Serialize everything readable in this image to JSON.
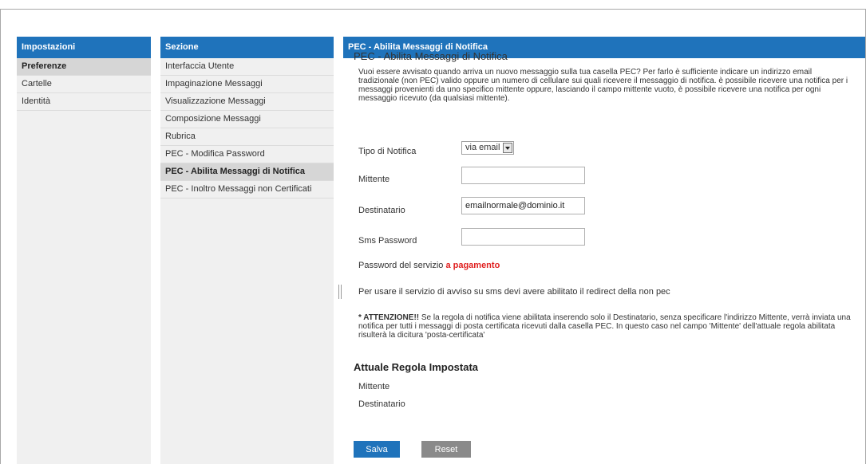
{
  "panel_impostazioni": {
    "header": "Impostazioni",
    "items": [
      "Preferenze",
      "Cartelle",
      "Identità"
    ]
  },
  "panel_sezione": {
    "header": "Sezione",
    "items": [
      "Interfaccia Utente",
      "Impaginazione Messaggi",
      "Visualizzazione Messaggi",
      "Composizione Messaggi",
      "Rubrica",
      "PEC - Modifica Password",
      "PEC - Abilita Messaggi di Notifica",
      "PEC - Inoltro Messaggi non Certificati"
    ]
  },
  "main": {
    "header": "PEC - Abilita Messaggi di Notifica",
    "title": "PEC - Abilita Messaggi di Notifica",
    "intro": "Vuoi essere avvisato quando arriva un nuovo messaggio sulla tua casella PEC? Per farlo è sufficiente indicare un indirizzo email tradizionale (non PEC) valido oppure un numero di cellulare sui quali ricevere il messaggio di notifica. è possibile ricevere una notifica per i messaggi provenienti da uno specifico mittente oppure, lasciando il campo mittente vuoto, è possibile ricevere una notifica per ogni messaggio ricevuto (da qualsiasi mittente).",
    "form": {
      "tipo_label": "Tipo di Notifica",
      "tipo_value": "via email",
      "mittente_label": "Mittente",
      "mittente_value": "",
      "destinatario_label": "Destinatario",
      "destinatario_value": "emailnormale@dominio.it",
      "sms_label": "Sms Password",
      "sms_value": ""
    },
    "paid_prefix": "Password del servizio",
    "paid_highlight": "a pagamento",
    "sms_note": "Per usare il servizio di avviso su sms devi avere abilitato il redirect della non pec",
    "warning_bold": "* ATTENZIONE!!",
    "warning_text": " Se la regola di notifica viene abilitata inserendo solo il Destinatario, senza specificare l'indirizzo Mittente, verrà inviata una notifica per tutti i messaggi di posta certificata ricevuti dalla casella PEC. In questo caso nel campo 'Mittente' dell'attuale regola abilitata risulterà la dicitura 'posta-certificata'",
    "current_rule_title": "Attuale Regola Impostata",
    "current_mittente_label": "Mittente",
    "current_destinatario_label": "Destinatario",
    "save_label": "Salva",
    "reset_label": "Reset"
  },
  "colors": {
    "header_blue": "#1f73bb",
    "accent_red": "#e02020",
    "reset_gray": "#8a8a8a"
  },
  "icons": {
    "select_arrow": "chevron-down-icon",
    "splitter": "splitter-handle-icon"
  }
}
